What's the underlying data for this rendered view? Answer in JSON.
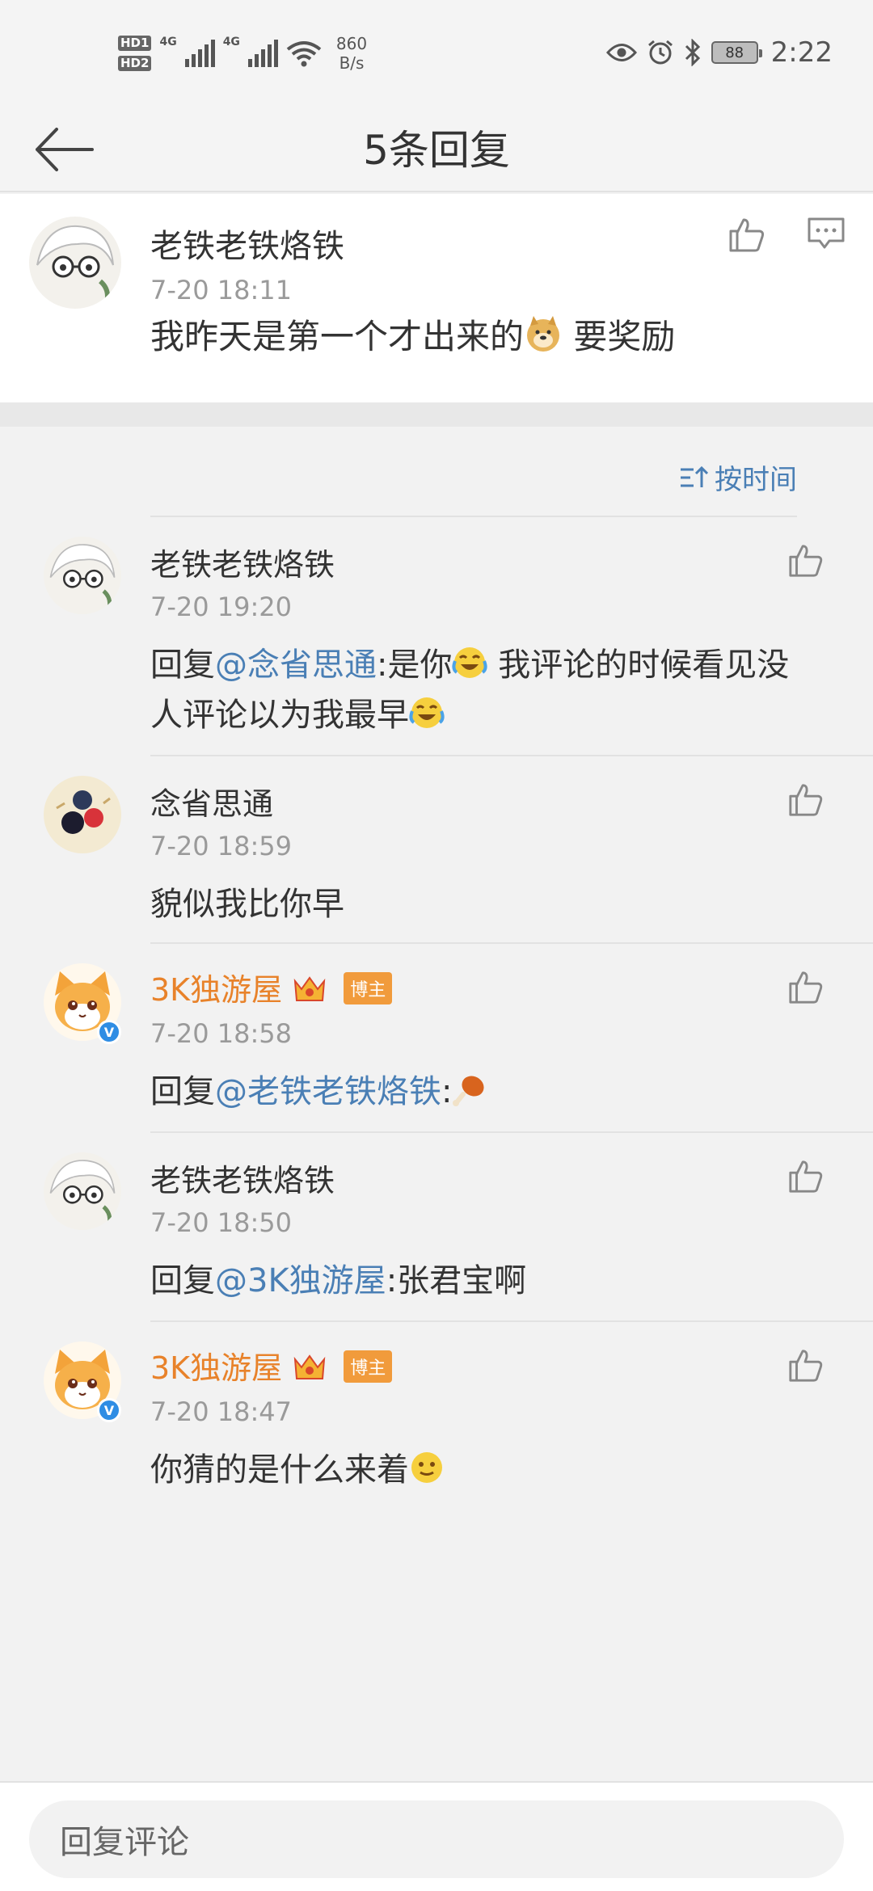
{
  "status_bar": {
    "hd1": "HD1",
    "hd2": "HD2",
    "net1": "4G",
    "net2": "4G",
    "speed_value": "860",
    "speed_unit": "B/s",
    "battery": "88",
    "time": "2:22"
  },
  "nav": {
    "title": "5条回复"
  },
  "main_comment": {
    "author": "老铁老铁烙铁",
    "time": "7-20 18:11",
    "text_before": "我昨天是第一个才出来的",
    "text_after": " 要奖励"
  },
  "sort": {
    "label": "按时间"
  },
  "replies": [
    {
      "author": "老铁老铁烙铁",
      "time": "7-20 19:20",
      "prefix": "回复",
      "mention": "@念省思通",
      "text": ":是你",
      "text2": " 我评论的时候看见没",
      "text3": "人评论以为我最早"
    },
    {
      "author": "念省思通",
      "time": "7-20 18:59",
      "text": "貌似我比你早"
    },
    {
      "author": "3K独游屋",
      "badge": "博主",
      "time": "7-20 18:58",
      "prefix": "回复",
      "mention": "@老铁老铁烙铁",
      "text": ":"
    },
    {
      "author": "老铁老铁烙铁",
      "time": "7-20 18:50",
      "prefix": "回复",
      "mention": "@3K独游屋",
      "text": ":张君宝啊"
    },
    {
      "author": "3K独游屋",
      "badge": "博主",
      "time": "7-20 18:47",
      "text": "你猜的是什么来着"
    }
  ],
  "bottom": {
    "placeholder": "回复评论"
  },
  "colors": {
    "link": "#4a7fb5",
    "blogger_name": "#e8822a",
    "badge": "#f19b3c",
    "verified": "#2f8de4"
  }
}
